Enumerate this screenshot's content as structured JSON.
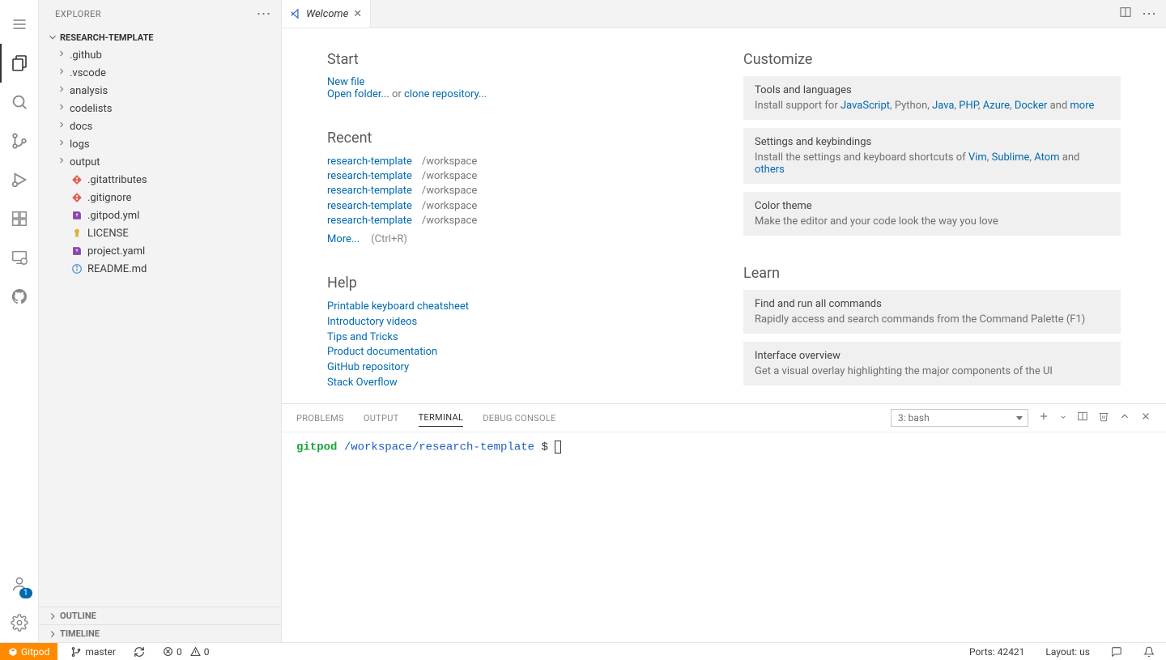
{
  "sidebar": {
    "title": "EXPLORER",
    "project": "RESEARCH-TEMPLATE",
    "tree": [
      {
        "kind": "folder",
        "name": ".github"
      },
      {
        "kind": "folder",
        "name": ".vscode"
      },
      {
        "kind": "folder",
        "name": "analysis"
      },
      {
        "kind": "folder",
        "name": "codelists"
      },
      {
        "kind": "folder",
        "name": "docs"
      },
      {
        "kind": "folder",
        "name": "logs"
      },
      {
        "kind": "folder",
        "name": "output"
      },
      {
        "kind": "file",
        "name": ".gitattributes",
        "icon": "git"
      },
      {
        "kind": "file",
        "name": ".gitignore",
        "icon": "git"
      },
      {
        "kind": "file",
        "name": ".gitpod.yml",
        "icon": "yml"
      },
      {
        "kind": "file",
        "name": "LICENSE",
        "icon": "license"
      },
      {
        "kind": "file",
        "name": "project.yaml",
        "icon": "yml"
      },
      {
        "kind": "file",
        "name": "README.md",
        "icon": "info"
      }
    ],
    "outline": "OUTLINE",
    "timeline": "TIMELINE",
    "accounts_badge": "1"
  },
  "tab": {
    "label": "Welcome"
  },
  "welcome": {
    "start_title": "Start",
    "new_file": "New file",
    "open_folder": "Open folder...",
    "or": " or ",
    "clone_repo": "clone repository...",
    "recent_title": "Recent",
    "recent": [
      {
        "name": "research-template",
        "path": "/workspace"
      },
      {
        "name": "research-template",
        "path": "/workspace"
      },
      {
        "name": "research-template",
        "path": "/workspace"
      },
      {
        "name": "research-template",
        "path": "/workspace"
      },
      {
        "name": "research-template",
        "path": "/workspace"
      }
    ],
    "more": "More...",
    "more_hint": "(Ctrl+R)",
    "help_title": "Help",
    "help_links": [
      "Printable keyboard cheatsheet",
      "Introductory videos",
      "Tips and Tricks",
      "Product documentation",
      "GitHub repository",
      "Stack Overflow"
    ],
    "customize_title": "Customize",
    "tools_title": "Tools and languages",
    "tools_prefix": "Install support for ",
    "tools_items": [
      "JavaScript",
      ", Python, ",
      "Java",
      ", ",
      "PHP",
      ", ",
      "Azure",
      ", ",
      "Docker"
    ],
    "tools_and": " and ",
    "tools_more": "more",
    "settings_title": "Settings and keybindings",
    "settings_prefix": "Install the settings and keyboard shortcuts of ",
    "settings_items": [
      "Vim",
      ", ",
      "Sublime",
      ", ",
      "Atom"
    ],
    "settings_and": " and ",
    "settings_others": "others",
    "theme_title": "Color theme",
    "theme_body": "Make the editor and your code look the way you love",
    "learn_title": "Learn",
    "cmd_title": "Find and run all commands",
    "cmd_body": "Rapidly access and search commands from the Command Palette (F1)",
    "ui_title": "Interface overview",
    "ui_body": "Get a visual overlay highlighting the major components of the UI"
  },
  "panel": {
    "tabs": [
      "PROBLEMS",
      "OUTPUT",
      "TERMINAL",
      "DEBUG CONSOLE"
    ],
    "active": "TERMINAL",
    "terminal_selector": "3: bash",
    "prompt_user": "gitpod",
    "prompt_path": "/workspace/research-template",
    "prompt_symbol": "$"
  },
  "statusbar": {
    "gitpod": "Gitpod",
    "branch": "master",
    "errors": "0",
    "warnings": "0",
    "ports": "Ports: 42421",
    "layout": "Layout: us"
  }
}
